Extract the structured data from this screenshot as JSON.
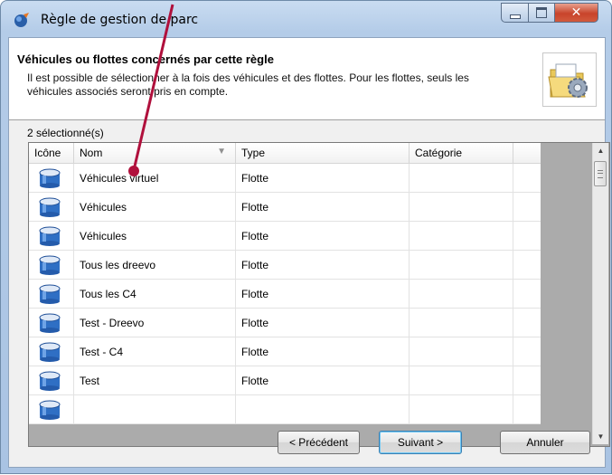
{
  "window": {
    "title": "Règle de gestion de parc",
    "close_glyph": "✕"
  },
  "header": {
    "title": "Véhicules ou flottes concernés par cette règle",
    "description": "Il est possible de sélectionner à la fois des véhicules et des flottes. Pour les flottes, seuls les véhicules associés seront pris en compte."
  },
  "selection": {
    "count_label": "2 sélectionné(s)"
  },
  "grid": {
    "columns": [
      "Icône",
      "Nom",
      "Type",
      "Catégorie"
    ],
    "rows": [
      {
        "nom": "Véhicules virtuel",
        "type": "Flotte",
        "categorie": ""
      },
      {
        "nom": "Véhicules",
        "type": "Flotte",
        "categorie": ""
      },
      {
        "nom": "Véhicules",
        "type": "Flotte",
        "categorie": ""
      },
      {
        "nom": "Tous les dreevo",
        "type": "Flotte",
        "categorie": ""
      },
      {
        "nom": "Tous les C4",
        "type": "Flotte",
        "categorie": ""
      },
      {
        "nom": "Test - Dreevo",
        "type": "Flotte",
        "categorie": ""
      },
      {
        "nom": "Test - C4",
        "type": "Flotte",
        "categorie": ""
      },
      {
        "nom": "Test",
        "type": "Flotte",
        "categorie": ""
      },
      {
        "nom": "",
        "type": "",
        "categorie": ""
      }
    ]
  },
  "buttons": {
    "previous": "< Précédent",
    "next": "Suivant >",
    "cancel": "Annuler"
  },
  "colors": {
    "annotation": "#b0103c",
    "drum_blue": "#2f6fc4"
  }
}
